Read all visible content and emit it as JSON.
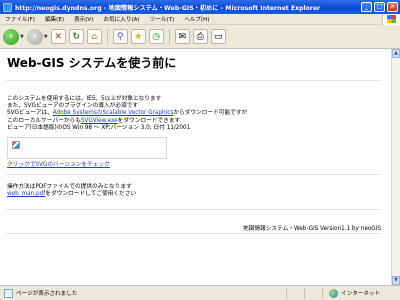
{
  "window": {
    "title": "http://neogis.dyndns.org - 地図情報システム・Web-GIS・初めに - Microsoft Internet Explorer",
    "min": "_",
    "max": "□",
    "close": "×"
  },
  "menu": [
    "ファイル(F)",
    "編集(E)",
    "表示(V)",
    "お気に入り(A)",
    "ツール(T)",
    "ヘルプ(H)"
  ],
  "page": {
    "heading": "Web-GIS システムを使う前に",
    "intro_lines": [
      "このシステムを使用するには、IE5、5以上が対象となります",
      "また、SVGビューアのプラグインの導入が必須です"
    ],
    "svg_line_pre": "SVGビューアは、",
    "svg_link": "Adobe SystemsのScalable Vector Graphics",
    "svg_line_post": "からダウンロード可能ですが",
    "local_line_pre": "このローカルサーバーからも",
    "local_link": "SVGView.exe",
    "local_line_post": "をダウンロードできます",
    "viewer_line": "ビューア(日本語版)のOS Win 98 ～ XP;バージョン 3.0; 日付 11/2001",
    "check_link": "クリックでSVGのバージョンをチェック",
    "manual_line": "操作方法はPDFファイルでの提供のみとなります",
    "manual_link": "web_man.pdf",
    "manual_line_post": "をダウンロードしてご使用ください",
    "footer": "地図情報システム・Web-GIS Version1.1 by neoGIS"
  },
  "status": {
    "text": "ページが表示されました",
    "zone": "インターネット"
  }
}
